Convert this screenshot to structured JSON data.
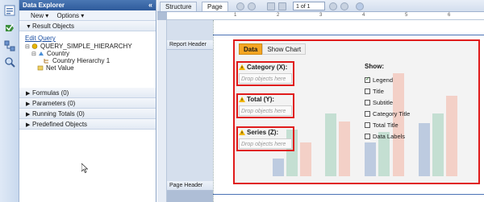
{
  "explorer": {
    "title": "Data Explorer",
    "collapse_glyph": "«",
    "menu": {
      "new_label": "New ▾",
      "options_label": "Options ▾"
    },
    "result_objects_label": "Result Objects",
    "edit_query_label": "Edit Query",
    "tree": {
      "query": "QUERY_SIMPLE_HIERARCHY",
      "country": "Country",
      "hierarchy": "Country Hierarchy 1",
      "net_value": "Net Value"
    },
    "sections": {
      "formulas": "Formulas (0)",
      "parameters": "Parameters (0)",
      "running_totals": "Running Totals (0)",
      "predefined": "Predefined Objects"
    }
  },
  "left_strip_icons": [
    "explorer-icon",
    "field-icon",
    "outline-icon",
    "find-icon"
  ],
  "tabs": {
    "structure": "Structure",
    "page": "Page"
  },
  "pager": {
    "page_text": "1 of 1"
  },
  "ruler_numbers": [
    "1",
    "2",
    "3",
    "4",
    "5",
    "6"
  ],
  "bands": {
    "report_header": "Report Header",
    "page_header": "Page Header"
  },
  "chart_editor": {
    "tab_data": "Data",
    "tab_show_chart": "Show Chart",
    "category_label": "Category (X):",
    "total_label": "Total (Y):",
    "series_label": "Series (Z):",
    "drop_placeholder": "Drop objects here",
    "show_title": "Show:",
    "options": [
      {
        "label": "Legend",
        "checked": true
      },
      {
        "label": "Title",
        "checked": false
      },
      {
        "label": "Subtitle",
        "checked": false
      },
      {
        "label": "Category Title",
        "checked": false
      },
      {
        "label": "Total Title",
        "checked": false
      },
      {
        "label": "Data Labels",
        "checked": false
      }
    ]
  },
  "colors": {
    "header_blue": "#2f5b9b",
    "highlight_red": "#e01b1b",
    "tab_orange": "#f5a623",
    "warning_yellow": "#f2b705"
  }
}
